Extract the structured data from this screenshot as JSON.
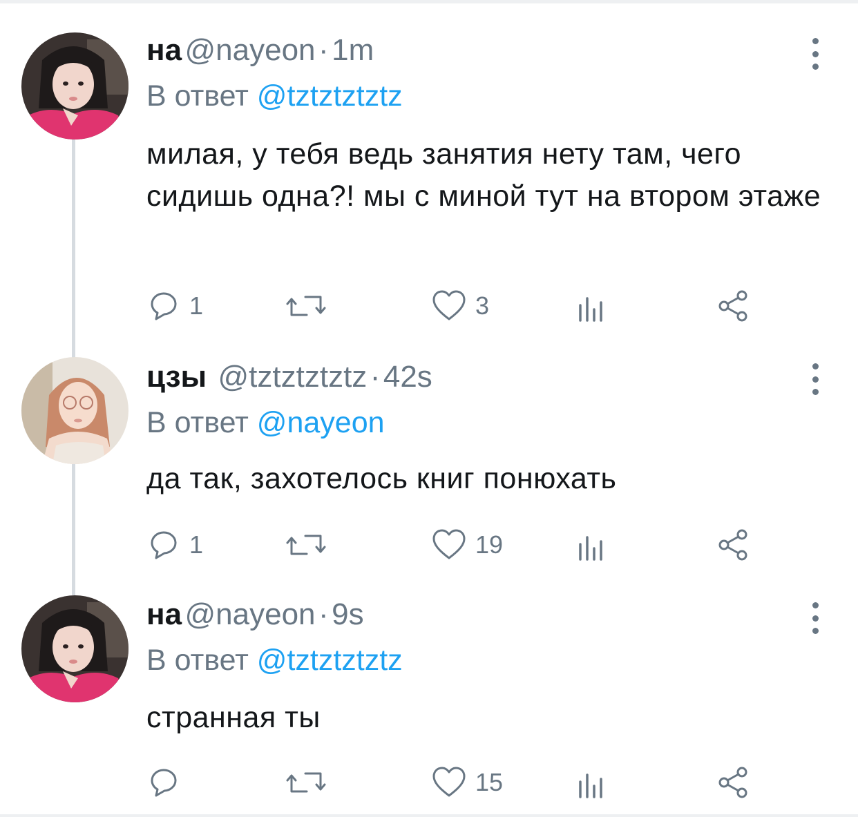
{
  "tweets": [
    {
      "name": "на",
      "handle": "@nayeon",
      "time": "1m",
      "reply_prefix": "В ответ",
      "reply_to": "@tztztztztz",
      "text": "милая, у тебя ведь занятия нету там, чего сидишь одна?! мы с миной тут на втором этаже",
      "avatar": "pink-sweater-avatar",
      "actions": {
        "reply_count": "1",
        "retweet_count": "",
        "like_count": "3"
      }
    },
    {
      "name": "цзы",
      "handle": "@tztztztztz",
      "time": "42s",
      "reply_prefix": "В ответ",
      "reply_to": "@nayeon",
      "text": "да так, захотелось книг понюхать",
      "avatar": "glasses-girl-avatar",
      "actions": {
        "reply_count": "1",
        "retweet_count": "",
        "like_count": "19"
      }
    },
    {
      "name": "на",
      "handle": "@nayeon",
      "time": "9s",
      "reply_prefix": "В ответ",
      "reply_to": "@tztztztztz",
      "text": "странная ты",
      "avatar": "pink-sweater-avatar",
      "actions": {
        "reply_count": "",
        "retweet_count": "",
        "like_count": "15"
      }
    }
  ],
  "separator": "·",
  "icons": [
    "reply-icon",
    "retweet-icon",
    "like-icon",
    "analytics-icon",
    "share-icon",
    "more-icon"
  ],
  "colors": {
    "link": "#1da1f2",
    "muted": "#687683",
    "text": "#14171a",
    "thread_line": "#d6dbe0"
  }
}
